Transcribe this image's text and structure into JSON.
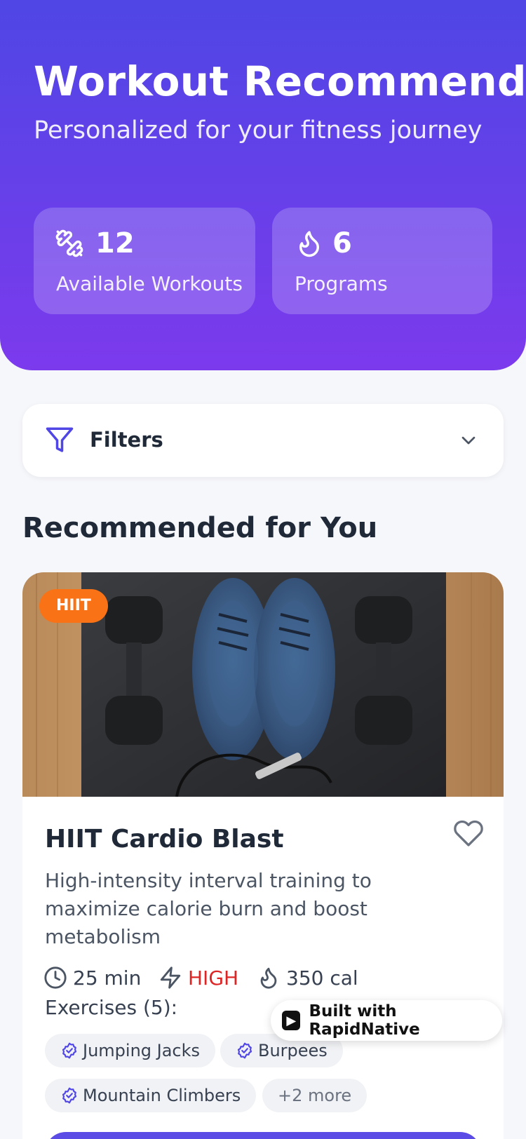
{
  "header": {
    "title": "Workout Recommendations",
    "subtitle": "Personalized for your fitness journey",
    "stats": [
      {
        "icon": "dumbbell-icon",
        "value": "12",
        "label": "Available Workouts"
      },
      {
        "icon": "flame-icon",
        "value": "6",
        "label": "Programs"
      }
    ]
  },
  "filters": {
    "label": "Filters",
    "icon": "filter-icon",
    "chevron": "chevron-down-icon"
  },
  "section": {
    "title": "Recommended for You"
  },
  "workout": {
    "badge": "HIIT",
    "title": "HIIT Cardio Blast",
    "description": "High-intensity interval training to maximize calorie burn and boost metabolism",
    "duration": "25 min",
    "intensity": "HIGH",
    "calories": "350 cal",
    "exercises_label": "Exercises (5):",
    "exercises": [
      "Jumping Jacks",
      "Burpees",
      "Mountain Climbers"
    ],
    "more": "+2 more"
  },
  "branding": {
    "label": "Built with RapidNative"
  },
  "colors": {
    "accent": "#5B4CE6",
    "badge": "#F97316",
    "intensity": "#DC2626"
  }
}
